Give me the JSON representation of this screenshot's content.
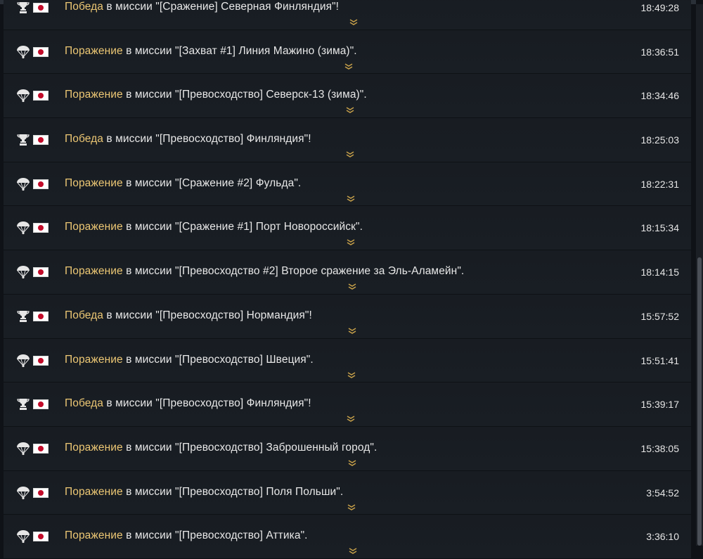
{
  "entries": [
    {
      "result": "Победа",
      "text": " в миссии \"[Сражение] Северная Финляндия\"!",
      "time": "18:49:28",
      "icon": "trophy-icon",
      "flag": "japan-flag-icon"
    },
    {
      "result": "Поражение",
      "text": " в миссии \"[Захват #1] Линия Мажино (зима)\".",
      "time": "18:36:51",
      "icon": "parachute-icon",
      "flag": "japan-flag-icon"
    },
    {
      "result": "Поражение",
      "text": " в миссии \"[Превосходство] Северск-13 (зима)\".",
      "time": "18:34:46",
      "icon": "parachute-icon",
      "flag": "japan-flag-icon"
    },
    {
      "result": "Победа",
      "text": " в миссии \"[Превосходство] Финляндия\"!",
      "time": "18:25:03",
      "icon": "trophy-icon",
      "flag": "japan-flag-icon"
    },
    {
      "result": "Поражение",
      "text": " в миссии \"[Сражение #2] Фульда\".",
      "time": "18:22:31",
      "icon": "parachute-icon",
      "flag": "japan-flag-icon"
    },
    {
      "result": "Поражение",
      "text": " в миссии \"[Сражение #1] Порт Новороссийск\".",
      "time": "18:15:34",
      "icon": "parachute-icon",
      "flag": "japan-flag-icon"
    },
    {
      "result": "Поражение",
      "text": " в миссии \"[Превосходство #2] Второе сражение за Эль-Аламейн\".",
      "time": "18:14:15",
      "icon": "parachute-icon",
      "flag": "japan-flag-icon"
    },
    {
      "result": "Победа",
      "text": " в миссии \"[Превосходство] Нормандия\"!",
      "time": "15:57:52",
      "icon": "trophy-icon",
      "flag": "japan-flag-icon"
    },
    {
      "result": "Поражение",
      "text": " в миссии \"[Превосходство] Швеция\".",
      "time": "15:51:41",
      "icon": "parachute-icon",
      "flag": "japan-flag-icon"
    },
    {
      "result": "Победа",
      "text": " в миссии \"[Превосходство] Финляндия\"!",
      "time": "15:39:17",
      "icon": "trophy-icon",
      "flag": "japan-flag-icon"
    },
    {
      "result": "Поражение",
      "text": " в миссии \"[Превосходство] Заброшенный город\".",
      "time": "15:38:05",
      "icon": "parachute-icon",
      "flag": "japan-flag-icon"
    },
    {
      "result": "Поражение",
      "text": " в миссии \"[Превосходство] Поля Польши\".",
      "time": "3:54:52",
      "icon": "parachute-icon",
      "flag": "japan-flag-icon"
    },
    {
      "result": "Поражение",
      "text": " в миссии \"[Превосходство] Аттика\".",
      "time": "3:36:10",
      "icon": "parachute-icon",
      "flag": "japan-flag-icon"
    }
  ],
  "colors": {
    "result_text": "#ecc774",
    "body_text": "#e8e8e8",
    "row_bg": "#181c22",
    "page_bg": "#0f1217",
    "accent_tab": "#c8321e",
    "expand_chevron": "#c9a24a"
  }
}
